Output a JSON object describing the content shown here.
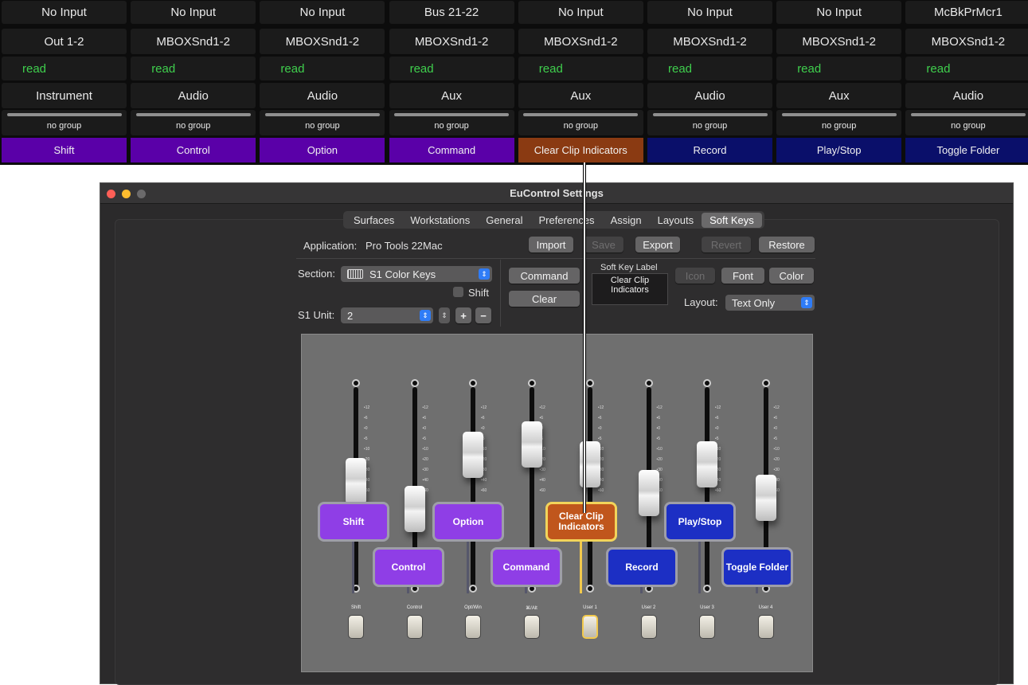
{
  "mixer_strip": {
    "channels": [
      {
        "input": "No Input",
        "output": "Out 1-2",
        "automation": "read",
        "type": "Instrument",
        "group": "no group",
        "soft_key": "Shift",
        "key_color": "#5a00a8"
      },
      {
        "input": "No Input",
        "output": "MBOXSnd1-2",
        "automation": "read",
        "type": "Audio",
        "group": "no group",
        "soft_key": "Control",
        "key_color": "#5a00a8"
      },
      {
        "input": "No Input",
        "output": "MBOXSnd1-2",
        "automation": "read",
        "type": "Audio",
        "group": "no group",
        "soft_key": "Option",
        "key_color": "#5a00a8"
      },
      {
        "input": "Bus 21-22",
        "output": "MBOXSnd1-2",
        "automation": "read",
        "type": "Aux",
        "group": "no group",
        "soft_key": "Command",
        "key_color": "#5a00a8"
      },
      {
        "input": "No Input",
        "output": "MBOXSnd1-2",
        "automation": "read",
        "type": "Aux",
        "group": "no group",
        "soft_key": "Clear Clip Indicators",
        "key_color": "#8a3a12"
      },
      {
        "input": "No Input",
        "output": "MBOXSnd1-2",
        "automation": "read",
        "type": "Audio",
        "group": "no group",
        "soft_key": "Record",
        "key_color": "#0a0f6a"
      },
      {
        "input": "No Input",
        "output": "MBOXSnd1-2",
        "automation": "read",
        "type": "Aux",
        "group": "no group",
        "soft_key": "Play/Stop",
        "key_color": "#0a0f6a"
      },
      {
        "input": "McBkPrMcr1",
        "output": "MBOXSnd1-2",
        "automation": "read",
        "type": "Audio",
        "group": "no group",
        "soft_key": "Toggle Folder",
        "key_color": "#0a0f6a"
      }
    ]
  },
  "window": {
    "title": "EuControl Settings",
    "tabs": [
      {
        "label": "Surfaces",
        "selected": false
      },
      {
        "label": "Workstations",
        "selected": false
      },
      {
        "label": "General",
        "selected": false
      },
      {
        "label": "Preferences",
        "selected": false
      },
      {
        "label": "Assign",
        "selected": false
      },
      {
        "label": "Layouts",
        "selected": false
      },
      {
        "label": "Soft Keys",
        "selected": true
      }
    ]
  },
  "soft_keys_panel": {
    "application_label": "Application:",
    "application_value": "Pro Tools 22Mac",
    "import_label": "Import",
    "save_label": "Save",
    "export_label": "Export",
    "revert_label": "Revert",
    "restore_label": "Restore",
    "section_label": "Section:",
    "section_value": "S1 Color Keys",
    "shift_label": "Shift",
    "unit_label": "S1 Unit:",
    "unit_value": "2",
    "plus_label": "+",
    "minus_label": "−",
    "command_label": "Command",
    "clear_label": "Clear",
    "soft_key_label_title": "Soft Key Label",
    "soft_key_label_value": "Clear Clip Indicators",
    "icon_label": "Icon",
    "font_label": "Font",
    "color_label": "Color",
    "layout_label": "Layout:",
    "layout_value": "Text Only"
  },
  "console": {
    "strips": [
      {
        "bottom_label": "Shift",
        "fader_level": 0.62
      },
      {
        "bottom_label": "Control",
        "fader_level": 0.45
      },
      {
        "bottom_label": "Opt/Win",
        "fader_level": 0.78
      },
      {
        "bottom_label": "⌘/Alt",
        "fader_level": 0.84
      },
      {
        "bottom_label": "User 1",
        "fader_level": 0.72
      },
      {
        "bottom_label": "User 2",
        "fader_level": 0.55
      },
      {
        "bottom_label": "User 3",
        "fader_level": 0.72
      },
      {
        "bottom_label": "User 4",
        "fader_level": 0.52
      }
    ],
    "soft_keys": [
      {
        "label": "Shift",
        "color": "#8f3ee6",
        "selected": false
      },
      {
        "label": "Control",
        "color": "#8f3ee6",
        "selected": false
      },
      {
        "label": "Option",
        "color": "#8f3ee6",
        "selected": false
      },
      {
        "label": "Command",
        "color": "#8f3ee6",
        "selected": false
      },
      {
        "label": "Clear Clip Indicators",
        "color": "#c0561c",
        "selected": true
      },
      {
        "label": "Record",
        "color": "#1c2fc4",
        "selected": false
      },
      {
        "label": "Play/Stop",
        "color": "#1c2fc4",
        "selected": false
      },
      {
        "label": "Toggle Folder",
        "color": "#1c2fc4",
        "selected": false
      }
    ]
  }
}
